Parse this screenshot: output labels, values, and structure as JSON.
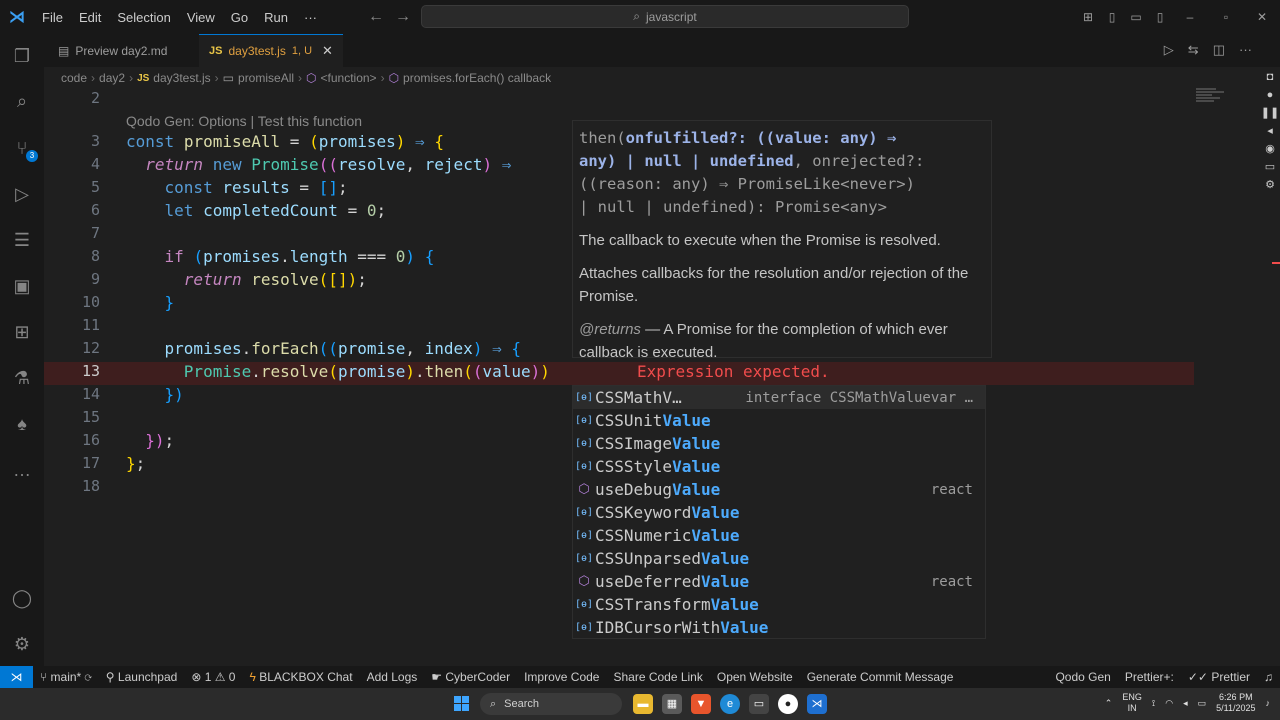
{
  "titlebar": {
    "menu": [
      "File",
      "Edit",
      "Selection",
      "View",
      "Go",
      "Run",
      "···"
    ],
    "search": "javascript"
  },
  "activity": {
    "scm_badge": "3"
  },
  "tabs": [
    {
      "label": "Preview day2.md",
      "active": false
    },
    {
      "label": "day3test.js",
      "status": "1, U",
      "active": true
    }
  ],
  "breadcrumb": [
    "code",
    "day2",
    "day3test.js",
    "promiseAll",
    "<function>",
    "promises.forEach() callback"
  ],
  "editor": {
    "codelens": "Qodo Gen: Options | Test this function",
    "line_numbers": [
      "2",
      "3",
      "4",
      "5",
      "6",
      "7",
      "8",
      "9",
      "10",
      "11",
      "12",
      "13",
      "14",
      "15",
      "16",
      "17",
      "18"
    ],
    "current_line": "13",
    "error_message": "Expression expected."
  },
  "hover": {
    "signature_1": "then(",
    "signature_b1": "onfulfilled?: ((value: any) ⇒",
    "signature_b2": "any) | null | undefined",
    "signature_2": ", onrejected?:",
    "signature_3": "((reason: any) ⇒ PromiseLike<never>)",
    "signature_4": "| null | undefined): Promise<any>",
    "param_doc": "The callback to execute when the Promise is resolved.",
    "doc": "Attaches callbacks for the resolution and/or rejection of the Promise.",
    "returns_tag": "@returns",
    "returns_text": "— A Promise for the completion of which ever callback is executed."
  },
  "suggest": [
    {
      "pre": "CSSMathV…",
      "match": "",
      "detail": "interface CSSMathValuevar …",
      "icon": "symbol-icon",
      "selected": true
    },
    {
      "pre": "CSSUnit",
      "match": "Value",
      "detail": "",
      "icon": "symbol-icon"
    },
    {
      "pre": "CSSImage",
      "match": "Value",
      "detail": "",
      "icon": "symbol-icon"
    },
    {
      "pre": "CSSStyle",
      "match": "Value",
      "detail": "",
      "icon": "symbol-icon"
    },
    {
      "pre": "useDebug",
      "match": "Value",
      "detail": "react",
      "icon": "cube-icon"
    },
    {
      "pre": "CSSKeyword",
      "match": "Value",
      "detail": "",
      "icon": "symbol-icon"
    },
    {
      "pre": "CSSNumeric",
      "match": "Value",
      "detail": "",
      "icon": "symbol-icon"
    },
    {
      "pre": "CSSUnparsed",
      "match": "Value",
      "detail": "",
      "icon": "symbol-icon"
    },
    {
      "pre": "useDeferred",
      "match": "Value",
      "detail": "react",
      "icon": "cube-icon"
    },
    {
      "pre": "CSSTransform",
      "match": "Value",
      "detail": "",
      "icon": "symbol-icon"
    },
    {
      "pre": "IDBCursorWith",
      "match": "Value",
      "detail": "",
      "icon": "symbol-icon"
    }
  ],
  "statusbar": {
    "branch": "main*",
    "launchpad": "Launchpad",
    "problems": "⊗ 1 ⚠ 0",
    "items": [
      "BLACKBOX Chat",
      "Add Logs",
      "CyberCoder",
      "Improve Code",
      "Share Code Link",
      "Open Website",
      "Generate Commit Message"
    ],
    "right": [
      "Qodo Gen",
      "Prettier+:",
      "Prettier"
    ]
  },
  "taskbar": {
    "search": "Search",
    "lang_1": "ENG",
    "lang_2": "IN",
    "time": "6:26 PM",
    "date": "5/11/2025"
  }
}
